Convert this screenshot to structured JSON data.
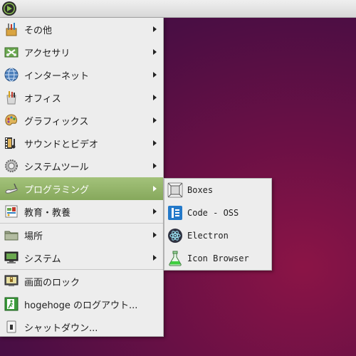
{
  "topbar": {
    "launcher_icon": "mint-logo-icon"
  },
  "menu": {
    "items": [
      {
        "label": "その他",
        "icon": "misc-tools-icon",
        "has_submenu": true
      },
      {
        "label": "アクセサリ",
        "icon": "accessories-icon",
        "has_submenu": true
      },
      {
        "label": "インターネット",
        "icon": "globe-icon",
        "has_submenu": true
      },
      {
        "label": "オフィス",
        "icon": "office-icon",
        "has_submenu": true
      },
      {
        "label": "グラフィックス",
        "icon": "palette-icon",
        "has_submenu": true
      },
      {
        "label": "サウンドとビデオ",
        "icon": "film-music-icon",
        "has_submenu": true
      },
      {
        "label": "システムツール",
        "icon": "gear-icon",
        "has_submenu": true
      },
      {
        "label": "プログラミング",
        "icon": "programming-icon",
        "has_submenu": true,
        "selected": true
      },
      {
        "label": "教育・教養",
        "icon": "education-icon",
        "has_submenu": true
      },
      {
        "label": "場所",
        "icon": "folder-icon",
        "has_submenu": true
      },
      {
        "label": "システム",
        "icon": "computer-icon",
        "has_submenu": true
      },
      {
        "label": "画面のロック",
        "icon": "lock-screen-icon",
        "has_submenu": false
      },
      {
        "label": "hogehoge のログアウト...",
        "icon": "logout-icon",
        "has_submenu": false
      },
      {
        "label": "シャットダウン...",
        "icon": "shutdown-icon",
        "has_submenu": false
      }
    ]
  },
  "submenu": {
    "items": [
      {
        "label": "Boxes",
        "icon": "boxes-icon"
      },
      {
        "label": "Code - OSS",
        "icon": "code-oss-icon"
      },
      {
        "label": "Electron",
        "icon": "electron-icon"
      },
      {
        "label": "Icon Browser",
        "icon": "flask-icon"
      }
    ]
  },
  "colors": {
    "highlight": "#94b56b",
    "menu_bg": "#ededed",
    "desktop": "#5a0f45"
  }
}
